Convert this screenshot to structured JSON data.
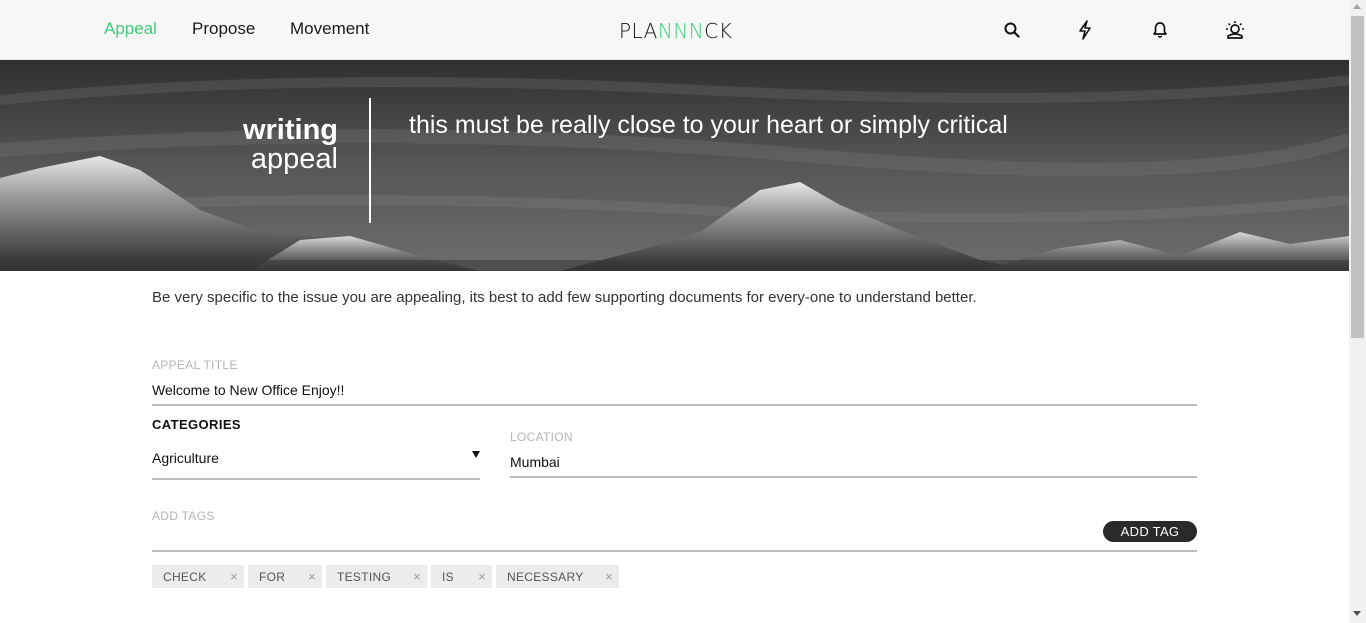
{
  "nav": {
    "links": [
      {
        "label": "Appeal",
        "active": true
      },
      {
        "label": "Propose",
        "active": false
      },
      {
        "label": "Movement",
        "active": false
      }
    ],
    "logo": {
      "left": "PLA",
      "mid": "NNN",
      "right": "CK"
    },
    "icons": [
      "search-icon",
      "flash-icon",
      "bell-icon",
      "user-icon"
    ]
  },
  "hero": {
    "title_line1": "writing",
    "title_line2": "appeal",
    "subtitle": "this must be really close to your heart or simply critical"
  },
  "form": {
    "intro": "Be very specific to the issue you are appealing, its best to add few supporting documents for every-one to understand better.",
    "appeal_title_label": "APPEAL TITLE",
    "appeal_title_value": "Welcome to New Office Enjoy!!",
    "categories_label": "CATEGORIES",
    "categories_value": "Agriculture",
    "location_label": "LOCATION",
    "location_value": "Mumbai",
    "tags_label": "ADD TAGS",
    "add_tag_button": "ADD TAG",
    "tags": [
      "CHECK",
      "FOR",
      "TESTING",
      "IS",
      "NECESSARY"
    ],
    "tag_remove_glyph": "×"
  },
  "colors": {
    "accent": "#3ccf7a",
    "button_dark": "#2a2a2a",
    "tag_bg": "#ececec"
  }
}
